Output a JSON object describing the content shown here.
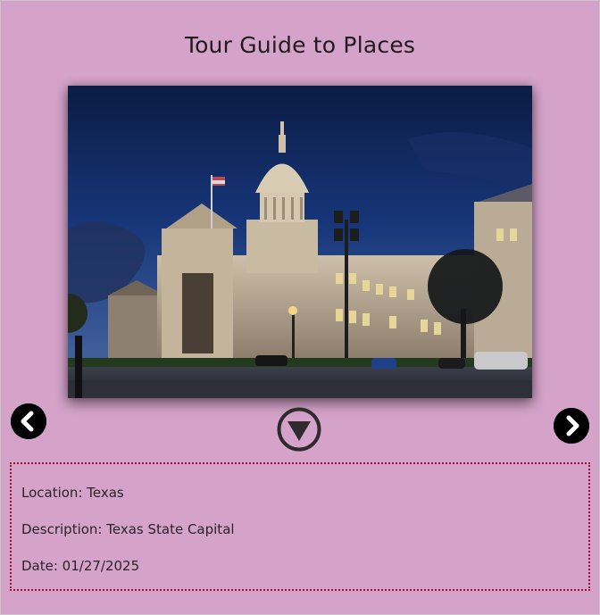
{
  "page": {
    "title": "Tour Guide to Places"
  },
  "photo": {
    "subject": "Texas State Capitol building at dusk"
  },
  "controls": {
    "prev_icon": "chevron-left-icon",
    "next_icon": "chevron-right-icon",
    "toggle_icon": "caret-down-circle-icon"
  },
  "info": {
    "location_label": "Location: Texas",
    "description_label": "Description: Texas State Capital",
    "date_label": "Date: 01/27/2025"
  },
  "colors": {
    "background": "#d5a3ca",
    "info_border": "#a3123a",
    "button": "#000000",
    "toggle": "#2e2a2e"
  }
}
